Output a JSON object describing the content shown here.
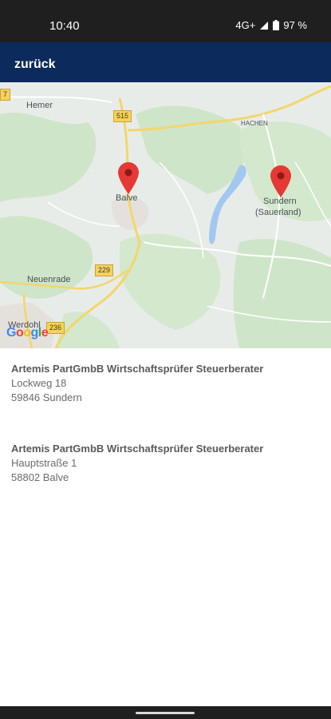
{
  "status_bar": {
    "time": "10:40",
    "network": "4G+",
    "battery": "97 %"
  },
  "app_bar": {
    "back_label": "zurück"
  },
  "map": {
    "places": {
      "hemer": "Hemer",
      "hachen": "HACHEN",
      "balve": "Balve",
      "sundern_line1": "Sundern",
      "sundern_line2": "(Sauerland)",
      "neuenrade": "Neuenrade",
      "werdohl": "Werdohl"
    },
    "road_shields": {
      "r515": "515",
      "r229": "229",
      "r236": "236",
      "r7": "7"
    },
    "logo": "Google",
    "pin_color": "#e53935"
  },
  "offices": [
    {
      "name": "Artemis PartGmbB Wirtschaftsprüfer Steuerberater",
      "street": "Lockweg 18",
      "city": "59846 Sundern"
    },
    {
      "name": "Artemis PartGmbB Wirtschaftsprüfer Steuerberater",
      "street": "Hauptstraße 1",
      "city": "58802 Balve"
    }
  ]
}
